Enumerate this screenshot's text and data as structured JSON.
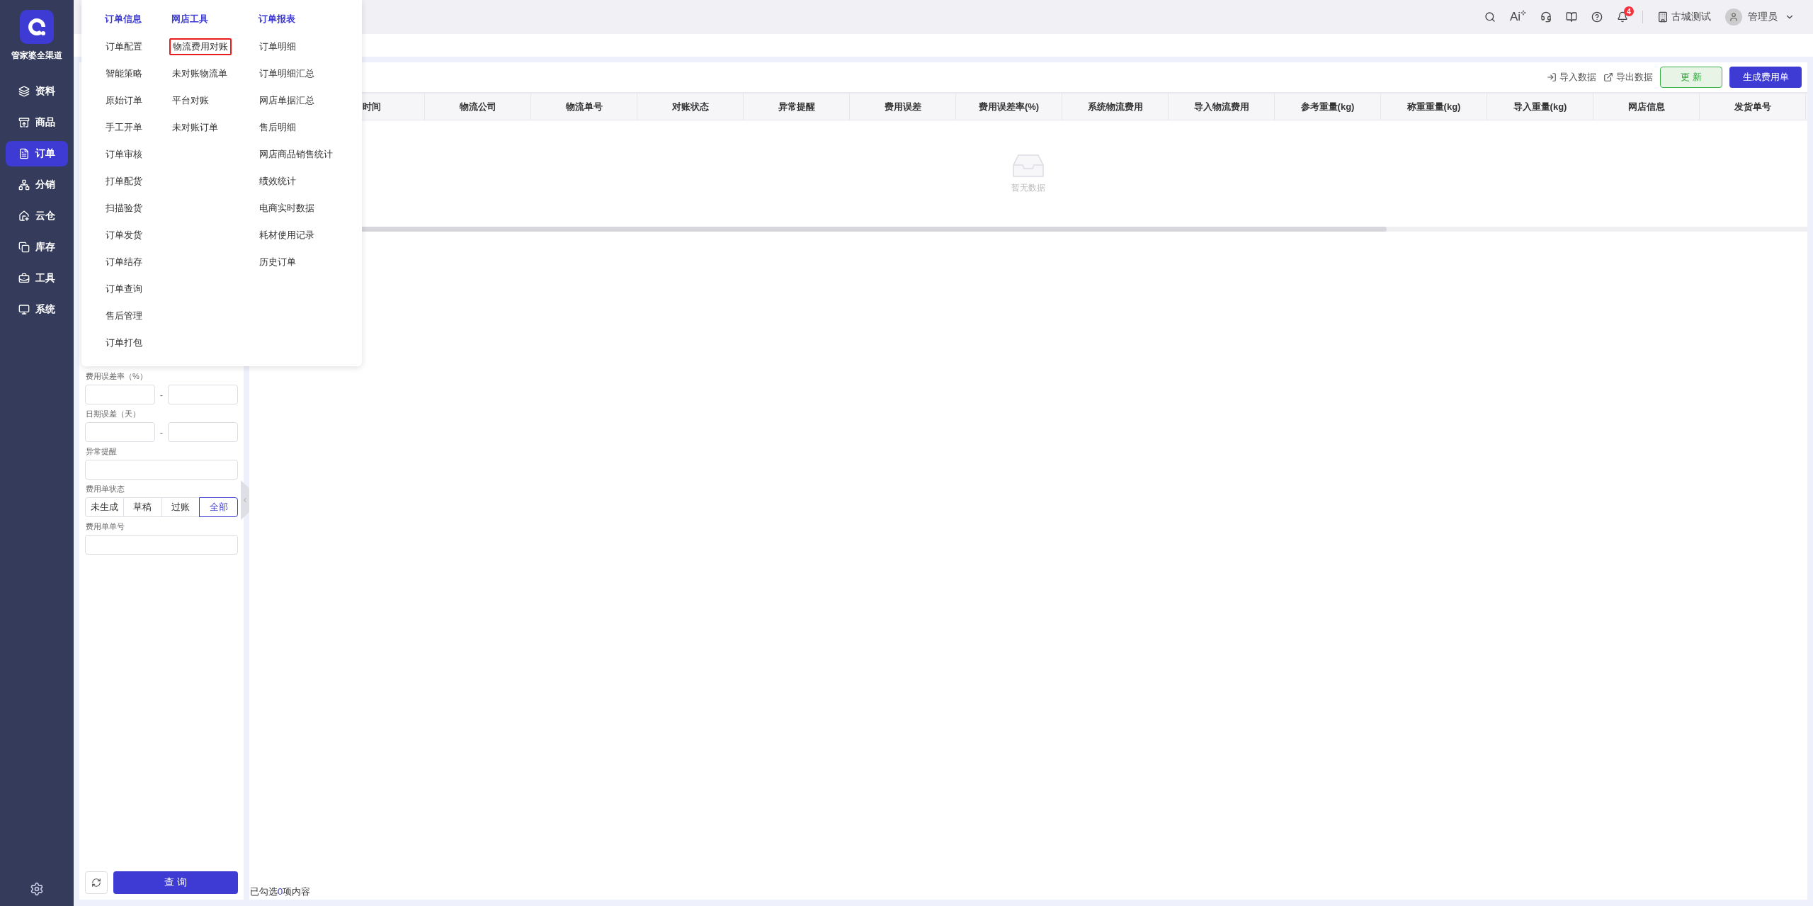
{
  "sidebar": {
    "logo_text": "管家婆全渠道",
    "items": [
      {
        "label": "资料",
        "selected": false
      },
      {
        "label": "商品",
        "selected": false
      },
      {
        "label": "订单",
        "selected": true
      },
      {
        "label": "分销",
        "selected": false
      },
      {
        "label": "云仓",
        "selected": false
      },
      {
        "label": "库存",
        "selected": false
      },
      {
        "label": "工具",
        "selected": false
      },
      {
        "label": "系统",
        "selected": false
      }
    ]
  },
  "top_bar": {
    "ai_label": "Ai",
    "notification_count": "4",
    "store": "古城测试",
    "user": "管理员"
  },
  "mega_menu": {
    "columns": [
      {
        "heading": "订单信息",
        "items": [
          {
            "label": "订单配置",
            "highlighted": false
          },
          {
            "label": "智能策略",
            "highlighted": false
          },
          {
            "label": "原始订单",
            "highlighted": false
          },
          {
            "label": "手工开单",
            "highlighted": false
          },
          {
            "label": "订单审核",
            "highlighted": false
          },
          {
            "label": "打单配货",
            "highlighted": false
          },
          {
            "label": "扫描验货",
            "highlighted": false
          },
          {
            "label": "订单发货",
            "highlighted": false
          },
          {
            "label": "订单结存",
            "highlighted": false
          },
          {
            "label": "订单查询",
            "highlighted": false
          },
          {
            "label": "售后管理",
            "highlighted": false
          },
          {
            "label": "订单打包",
            "highlighted": false
          }
        ]
      },
      {
        "heading": "网店工具",
        "items": [
          {
            "label": "物流费用对账",
            "highlighted": true
          },
          {
            "label": "未对账物流单",
            "highlighted": false
          },
          {
            "label": "平台对账",
            "highlighted": false
          },
          {
            "label": "未对账订单",
            "highlighted": false
          }
        ]
      },
      {
        "heading": "订单报表",
        "items": [
          {
            "label": "订单明细",
            "highlighted": false
          },
          {
            "label": "订单明细汇总",
            "highlighted": false
          },
          {
            "label": "网店单据汇总",
            "highlighted": false
          },
          {
            "label": "售后明细",
            "highlighted": false
          },
          {
            "label": "网店商品销售统计",
            "highlighted": false
          },
          {
            "label": "绩效统计",
            "highlighted": false
          },
          {
            "label": "电商实时数据",
            "highlighted": false
          },
          {
            "label": "耗材使用记录",
            "highlighted": false
          },
          {
            "label": "历史订单",
            "highlighted": false
          }
        ]
      }
    ]
  },
  "filters": {
    "fields": [
      {
        "kind": "range",
        "label": "费用误差率（%）",
        "separator": "-"
      },
      {
        "kind": "range",
        "label": "日期误差（天）",
        "separator": "-"
      },
      {
        "kind": "text",
        "label": "异常提醒"
      },
      {
        "kind": "segmented",
        "label": "费用单状态",
        "options": [
          {
            "label": "未生成",
            "selected": false
          },
          {
            "label": "草稿",
            "selected": false
          },
          {
            "label": "过账",
            "selected": false
          },
          {
            "label": "全部",
            "selected": true
          }
        ]
      },
      {
        "kind": "text",
        "label": "费用单单号"
      }
    ],
    "query_button": "查 询"
  },
  "toolbar": {
    "import": "导入数据",
    "export": "导出数据",
    "refresh": "更 新",
    "generate": "生成费用单"
  },
  "table": {
    "columns": [
      "时间",
      "物流公司",
      "物流单号",
      "对账状态",
      "异常提醒",
      "费用误差",
      "费用误差率(%)",
      "系统物流费用",
      "导入物流费用",
      "参考重量(kg)",
      "称重重量(kg)",
      "导入重量(kg)",
      "网店信息",
      "发货单号"
    ],
    "empty_text": "暂无数据"
  },
  "footer": {
    "prefix": "已勾选",
    "count": "0",
    "suffix": "项内容"
  }
}
